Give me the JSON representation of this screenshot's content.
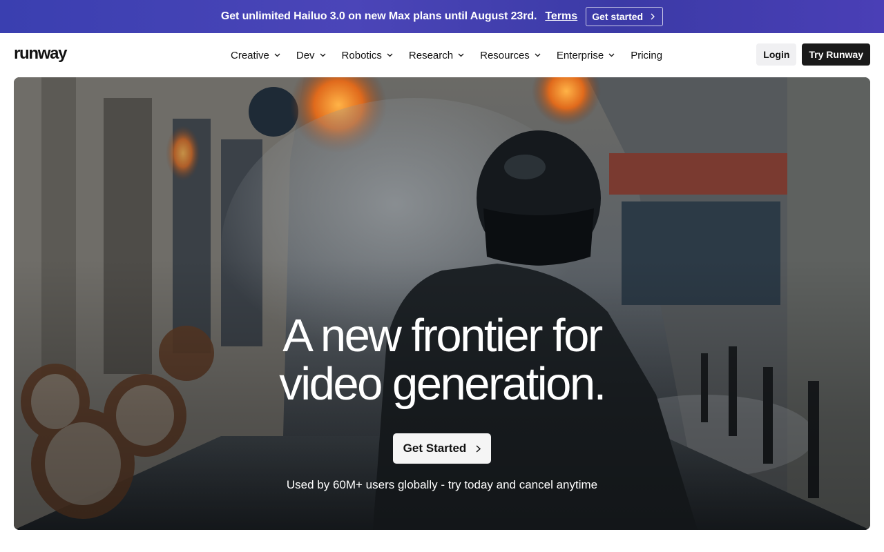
{
  "promo": {
    "text": "Get unlimited Hailuo 3.0 on new Max plans until August 23rd.",
    "terms_label": "Terms",
    "cta_label": "Get started"
  },
  "header": {
    "logo": "runway",
    "nav": [
      {
        "label": "Creative",
        "dropdown": true
      },
      {
        "label": "Dev",
        "dropdown": true
      },
      {
        "label": "Robotics",
        "dropdown": true
      },
      {
        "label": "Research",
        "dropdown": true
      },
      {
        "label": "Resources",
        "dropdown": true
      },
      {
        "label": "Enterprise",
        "dropdown": true
      },
      {
        "label": "Pricing",
        "dropdown": false
      }
    ],
    "login_label": "Login",
    "try_label": "Try Runway"
  },
  "hero": {
    "title_line1": "A new frontier for",
    "title_line2": "video generation.",
    "cta_label": "Get Started",
    "subtext": "Used by 60M+ users globally - try today and cancel anytime"
  },
  "colors": {
    "banner": "#4042b0",
    "dark_button": "#1a1a1a",
    "light_button": "#f0f0f2"
  },
  "icons": {
    "nav_dropdown": "chevron-down-icon",
    "cta_arrow": "chevron-right-icon"
  }
}
